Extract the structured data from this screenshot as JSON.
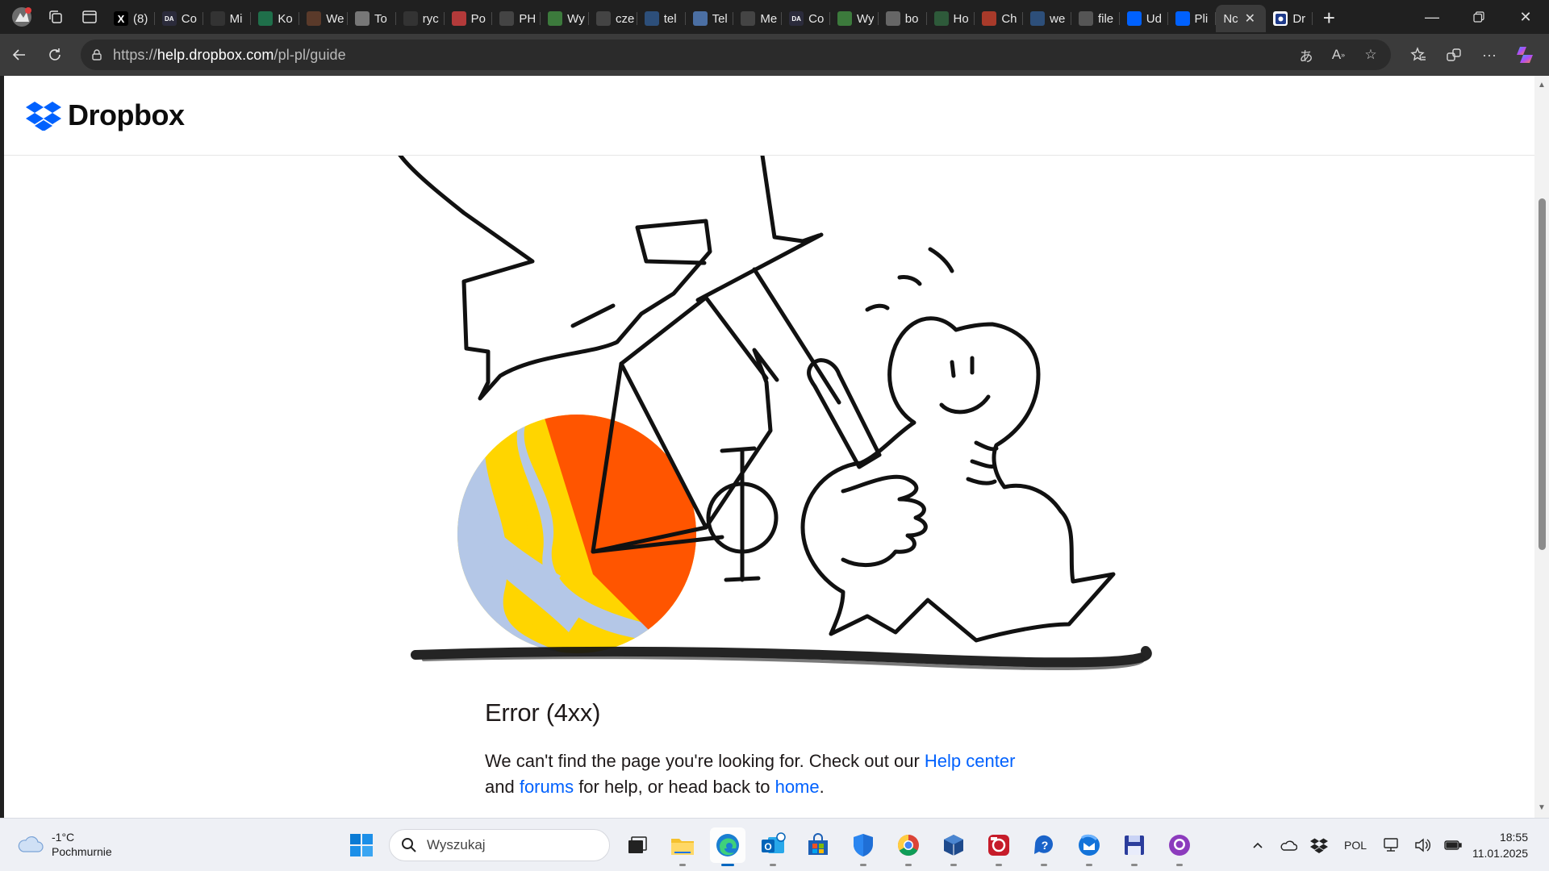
{
  "browser": {
    "tabs": [
      {
        "label": "(8)",
        "icon": "x-logo-icon",
        "color": "#000000",
        "glyph": "X"
      },
      {
        "label": "Co",
        "icon": "da-icon",
        "color": "#2b2b3b",
        "glyph": "DA"
      },
      {
        "label": "Mi",
        "icon": "circle-icon",
        "color": "#333333",
        "glyph": ""
      },
      {
        "label": "Ko",
        "icon": "globe-green-icon",
        "color": "#1f6f4a",
        "glyph": ""
      },
      {
        "label": "We",
        "icon": "brown-icon",
        "color": "#5a3a2a",
        "glyph": ""
      },
      {
        "label": "To",
        "icon": "grey-square-icon",
        "color": "#777777",
        "glyph": ""
      },
      {
        "label": "ryc",
        "icon": "circle-icon",
        "color": "#333333",
        "glyph": ""
      },
      {
        "label": "Po",
        "icon": "eagle-icon",
        "color": "#b33a3a",
        "glyph": ""
      },
      {
        "label": "PH",
        "icon": "page-icon",
        "color": "#444444",
        "glyph": ""
      },
      {
        "label": "Wy",
        "icon": "ms-icon",
        "color": "#3c7a3c",
        "glyph": ""
      },
      {
        "label": "cze",
        "icon": "page-icon",
        "color": "#444444",
        "glyph": ""
      },
      {
        "label": "tel",
        "icon": "search-icon",
        "color": "#2d4f7a",
        "glyph": ""
      },
      {
        "label": "Tel",
        "icon": "tel-icon",
        "color": "#4b6fa3",
        "glyph": ""
      },
      {
        "label": "Me",
        "icon": "page-icon",
        "color": "#444444",
        "glyph": ""
      },
      {
        "label": "Co",
        "icon": "da-icon",
        "color": "#2b2b3b",
        "glyph": "DA"
      },
      {
        "label": "Wy",
        "icon": "ms-icon",
        "color": "#3c7a3c",
        "glyph": ""
      },
      {
        "label": "bo",
        "icon": "grey-doc-icon",
        "color": "#666666",
        "glyph": ""
      },
      {
        "label": "Ho",
        "icon": "leaf-icon",
        "color": "#2e5a3a",
        "glyph": ""
      },
      {
        "label": "Ch",
        "icon": "red-ball-icon",
        "color": "#a83a2a",
        "glyph": ""
      },
      {
        "label": "we",
        "icon": "search-icon",
        "color": "#2d4f7a",
        "glyph": ""
      },
      {
        "label": "file",
        "icon": "file-icon",
        "color": "#555555",
        "glyph": ""
      },
      {
        "label": "Ud",
        "icon": "dropbox-icon",
        "color": "#0061fe",
        "glyph": ""
      },
      {
        "label": "Pli",
        "icon": "dropbox-icon",
        "color": "#0061fe",
        "glyph": ""
      }
    ],
    "active_tab": {
      "label": "Nc",
      "icon": "dropbox-icon"
    },
    "last_tab": {
      "label": "Dr",
      "icon": "dropbox-dark-icon"
    },
    "url_scheme": "https://",
    "url_host": "help.dropbox.com",
    "url_path": "/pl-pl/guide"
  },
  "page": {
    "brand": "Dropbox",
    "error_title": "Error (4xx)",
    "msg_part1": "We can't find the page you're looking for. Check out our ",
    "link_help": "Help center",
    "msg_part2": " and ",
    "link_forums": "forums",
    "msg_part3": " for help, or head back to ",
    "link_home": "home",
    "msg_part4": "."
  },
  "taskbar": {
    "weather_temp": "-1°C",
    "weather_desc": "Pochmurnie",
    "search_placeholder": "Wyszukaj",
    "language": "POL",
    "time": "18:55",
    "date": "11.01.2025"
  },
  "colors": {
    "dropbox_blue": "#0061fe",
    "ball_yellow": "#ffd500",
    "ball_blue": "#b4c7e7",
    "ball_orange": "#ff5500"
  }
}
